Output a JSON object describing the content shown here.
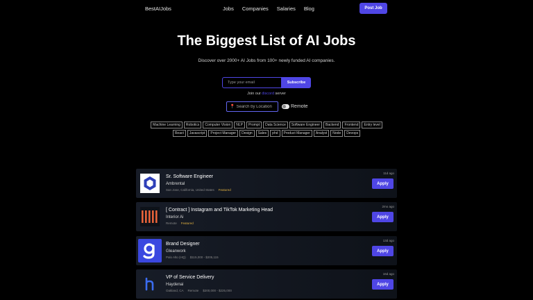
{
  "nav": {
    "logo": "BestAIJobs",
    "links": [
      "Jobs",
      "Companies",
      "Salaries",
      "Blog"
    ],
    "post_button": "Post Job"
  },
  "hero": {
    "title": "The Biggest List of AI Jobs",
    "subtitle": "Discover over 2000+ AI Jobs from 100+ newly funded AI companies."
  },
  "subscribe": {
    "email_placeholder": "Type your email",
    "button": "Subscribe",
    "join_prefix": "Join our",
    "join_link": "discord",
    "join_suffix": "server"
  },
  "filters": {
    "location_placeholder": "Search by Location",
    "remote_label": "Remote",
    "remote_on": false,
    "accent_color": "#4f46e5"
  },
  "tags_row1": [
    "Machine Learning",
    "Robotics",
    "Computer Vision",
    "NLP",
    "Prompt",
    "Data Science",
    "Software Engineer",
    "Backend",
    "Frontend",
    "Entry level"
  ],
  "tags_row2": [
    "React",
    "Javascript",
    "Project Manager",
    "Design",
    "Sales",
    "phd",
    "Product Manager",
    "Analyst",
    "Node",
    "Devops"
  ],
  "jobs": [
    {
      "title": "Sr. Software Engineer",
      "company": "Ambrental",
      "location": "San Jose, California, United States",
      "salary": "",
      "featured": "Featured",
      "age": "11d ago",
      "apply": "Apply",
      "logo_icon": "hexagon-logo-icon"
    },
    {
      "title": "[ Contract ] Instagram and TikTok Marketing Head",
      "company": "Interior Ai",
      "location": "Remote",
      "salary": "",
      "featured": "Featured",
      "age": "2mo ago",
      "apply": "Apply",
      "logo_icon": "bars-logo-icon"
    },
    {
      "title": "Brand Designer",
      "company": "Gleanwork",
      "location": "Palo Alto (HQ)",
      "salary": "$115,000 - $205,115",
      "featured": "",
      "age": "13d ago",
      "apply": "Apply",
      "logo_icon": "g-logo-icon"
    },
    {
      "title": "VP of Service Delivery",
      "company": "Haydenai",
      "location": "Oakland, CA",
      "location2": "Remote",
      "salary": "$200,000 - $225,000",
      "featured": "",
      "age": "16d ago",
      "apply": "Apply",
      "logo_icon": "h-logo-icon"
    }
  ]
}
